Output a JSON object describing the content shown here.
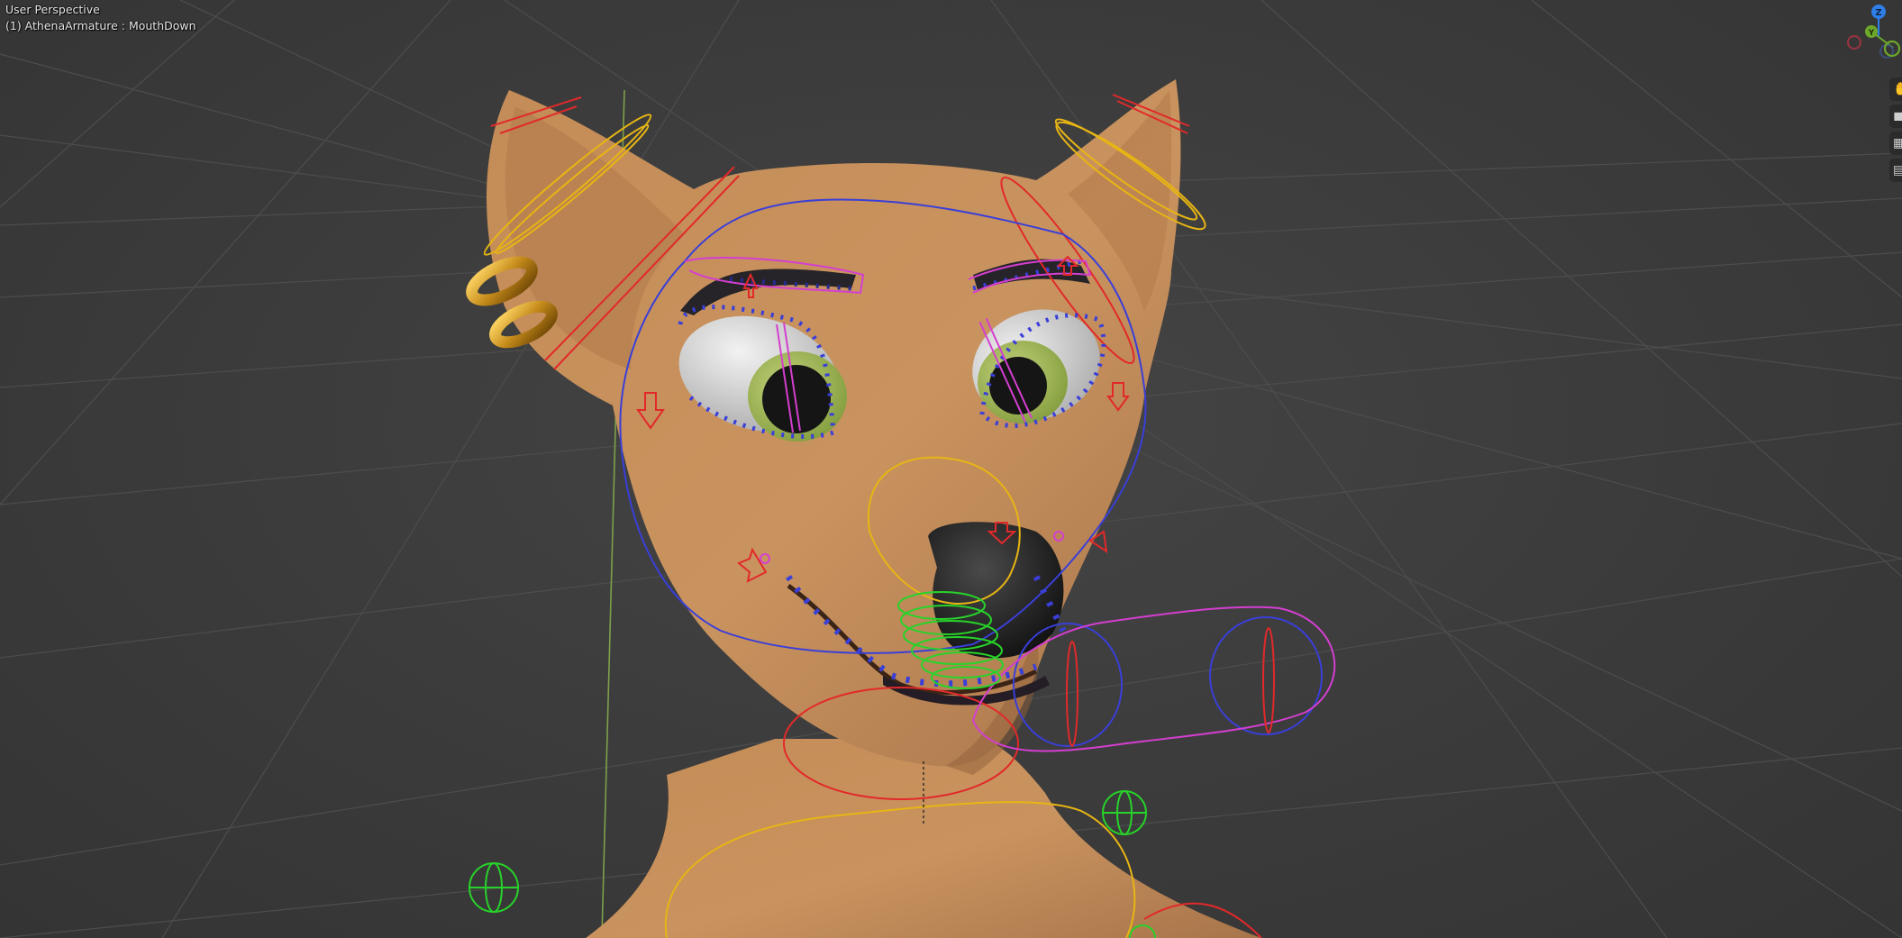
{
  "viewport": {
    "view_label": "User Perspective",
    "active_object_label": "(1) AthenaArmature : MouthDown"
  },
  "gizmo": {
    "axes": [
      {
        "name": "Z",
        "color": "#2f7ee8"
      },
      {
        "name": "Y",
        "color": "#6da82a"
      },
      {
        "name": "X",
        "color": "#d6414f"
      }
    ]
  },
  "side_tools": [
    {
      "icon": "hand-icon"
    },
    {
      "icon": "camera-icon"
    },
    {
      "icon": "grid-icon"
    },
    {
      "icon": "perspective-icon"
    }
  ],
  "colors": {
    "background": "#3d3d3d",
    "skin": "#c58f5c",
    "bone_red": "#e2292a",
    "bone_yellow": "#e7b514",
    "bone_blue": "#3a3fd8",
    "bone_magenta": "#d43fd0",
    "bone_green": "#27d32a"
  }
}
